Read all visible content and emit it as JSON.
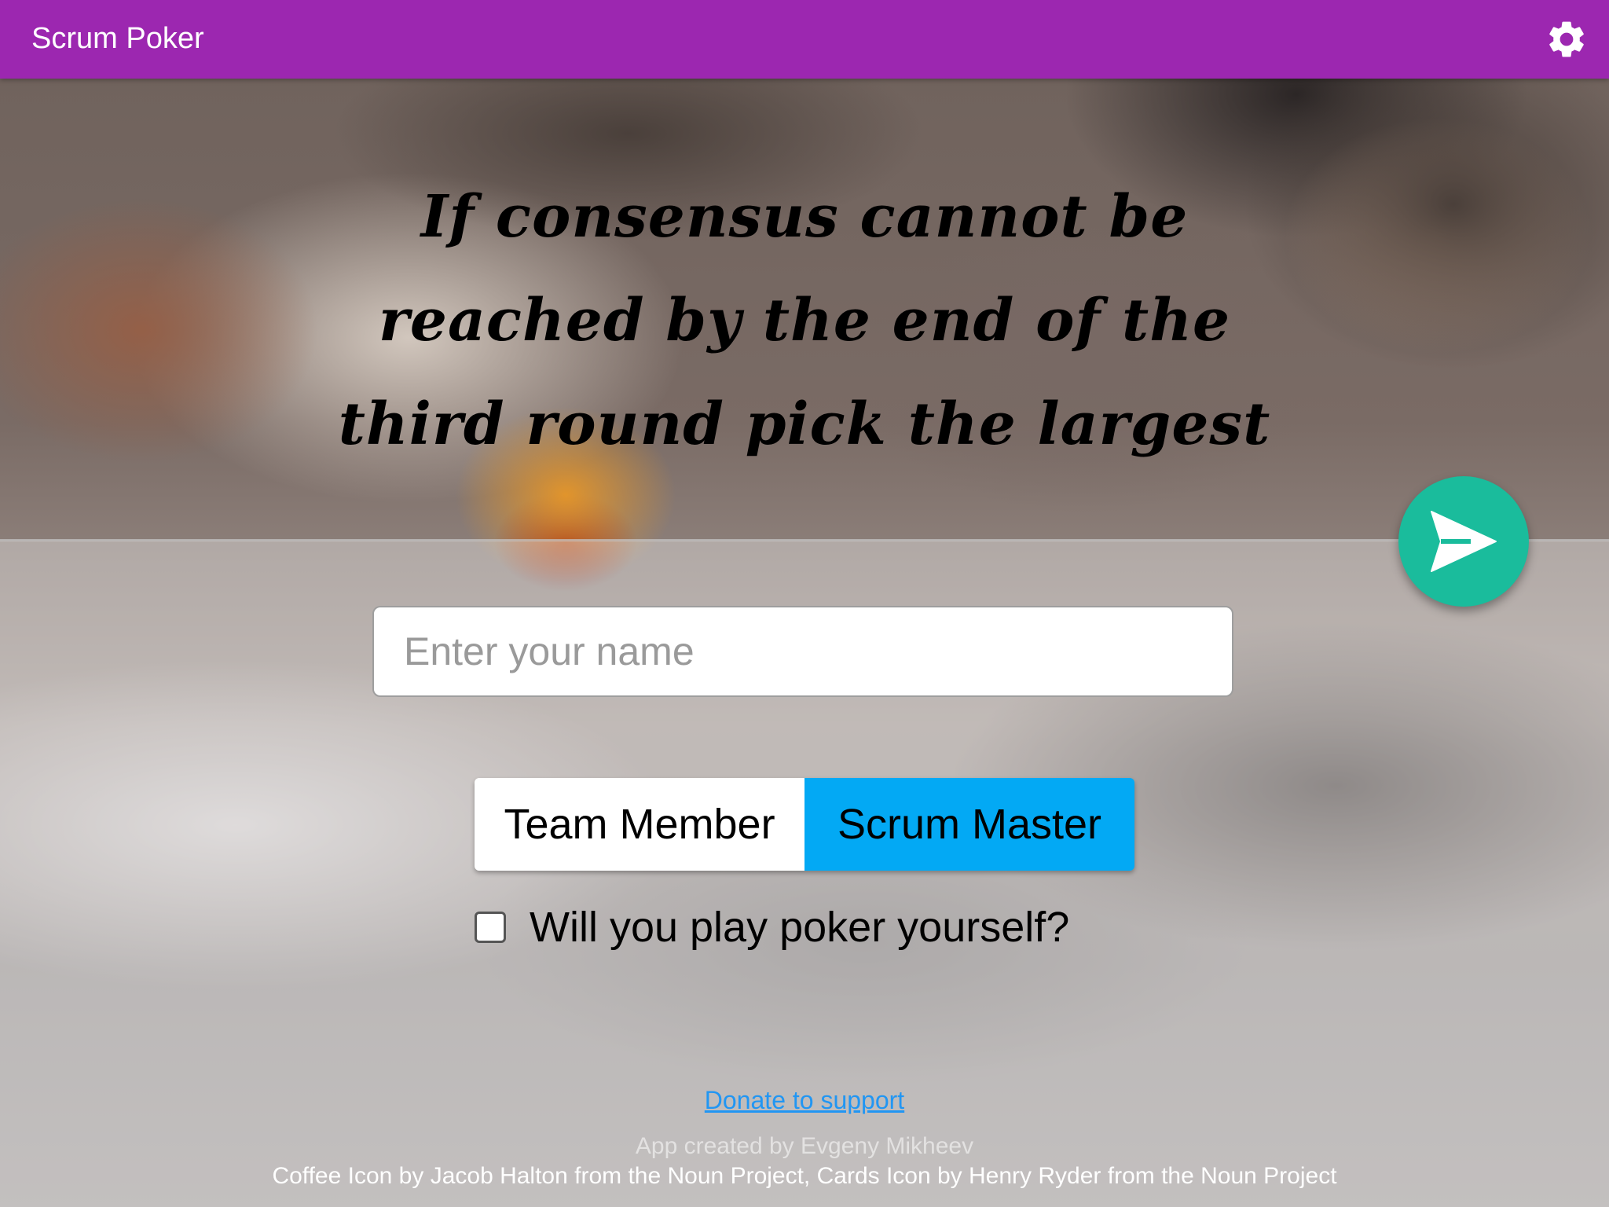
{
  "app_bar": {
    "title": "Scrum Poker",
    "settings_icon": "gear-icon",
    "background_color": "#9c27b0"
  },
  "quote": {
    "text": "If consensus cannot be reached by the end of the third round pick the largest"
  },
  "fab": {
    "icon": "send-icon",
    "color": "#1abc9c"
  },
  "name_input": {
    "placeholder": "Enter your name",
    "value": ""
  },
  "role_toggle": {
    "options": [
      {
        "label": "Team Member",
        "selected": false
      },
      {
        "label": "Scrum Master",
        "selected": true
      }
    ],
    "selected_color": "#03a9f4"
  },
  "play_checkbox": {
    "label": "Will you play poker yourself?",
    "checked": false
  },
  "footer": {
    "donate_link": "Donate to support",
    "created_by": "App created by Evgeny Mikheev",
    "icons_credit": "Coffee Icon by Jacob Halton from the Noun Project, Cards Icon by Henry Ryder from the Noun Project"
  }
}
